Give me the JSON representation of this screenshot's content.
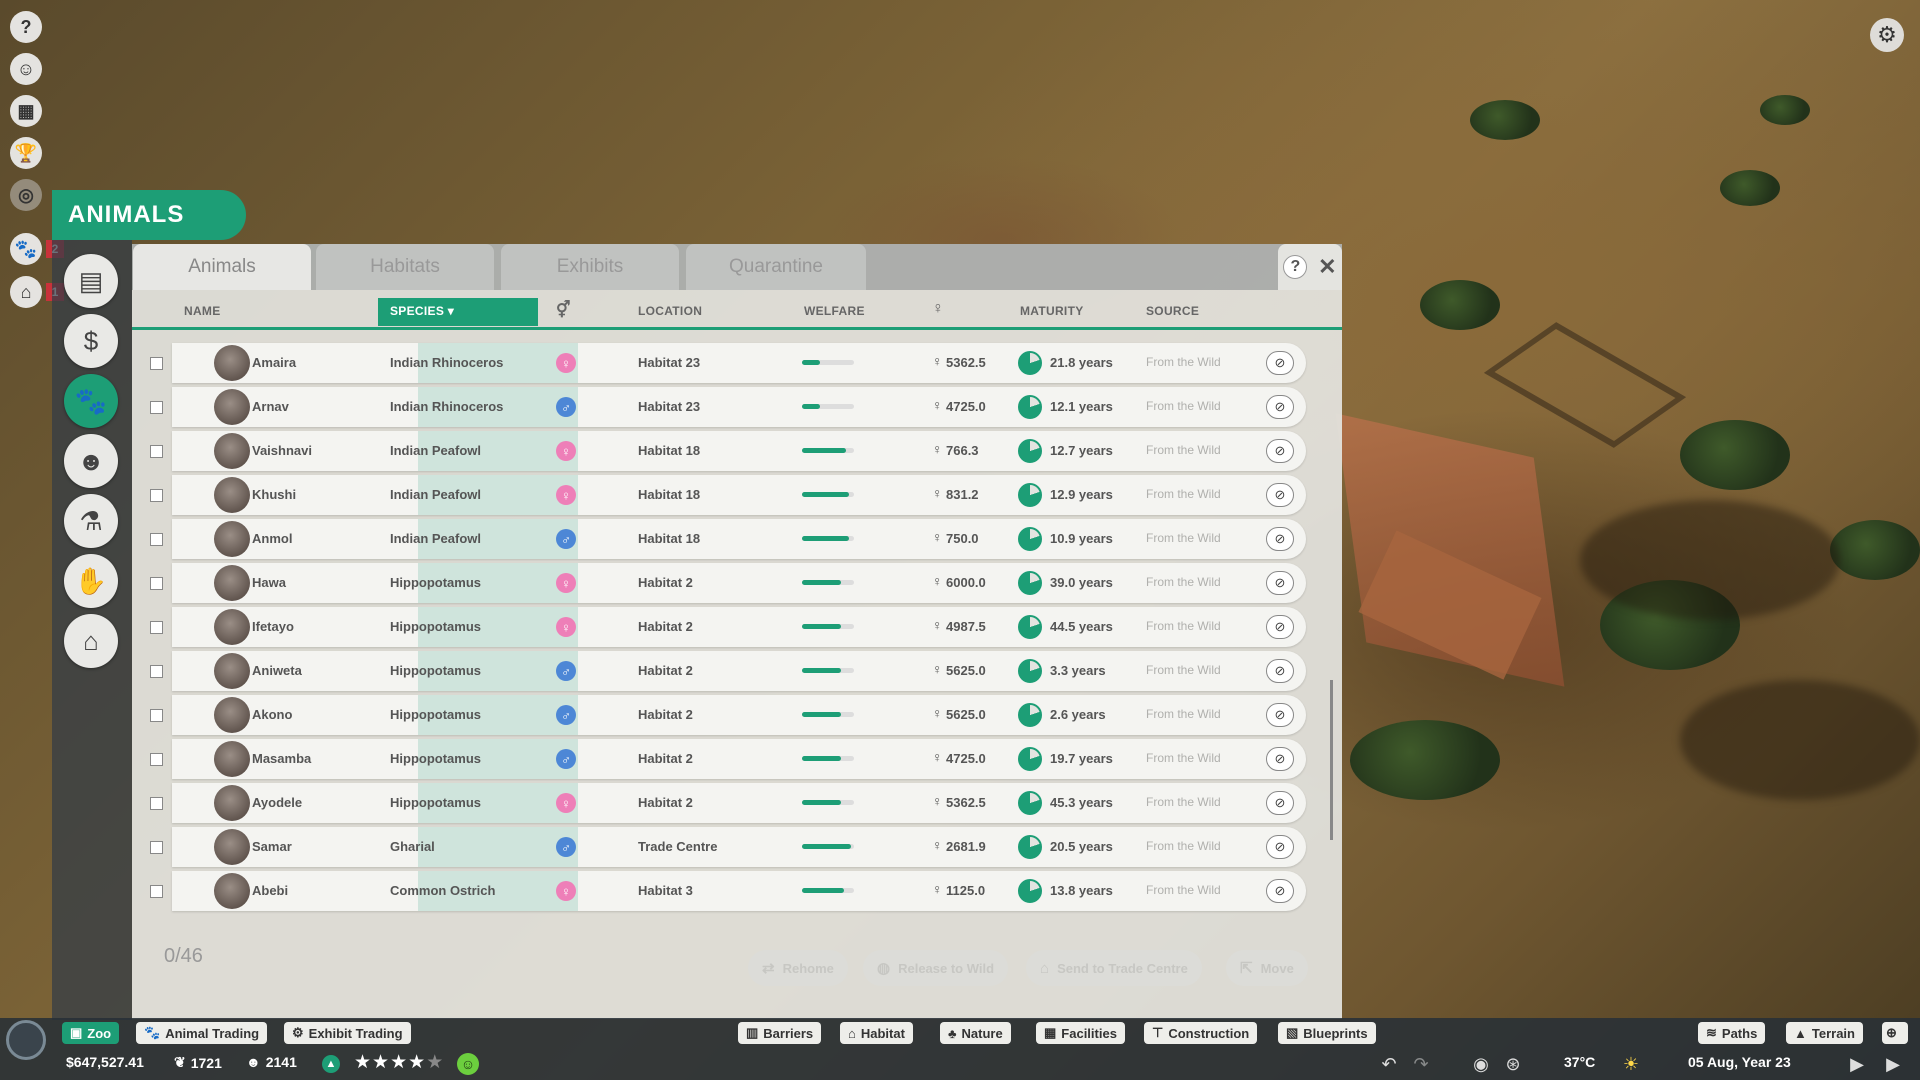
{
  "rail": {
    "icons": [
      "?",
      "☺",
      "▦",
      "🏆",
      "◎"
    ],
    "badges": [
      {
        "icon": "🐾",
        "count": "2"
      },
      {
        "icon": "⌂",
        "count": "1"
      }
    ]
  },
  "panel": {
    "title": "ANIMALS",
    "tabs": [
      "Animals",
      "Habitats",
      "Exhibits",
      "Quarantine"
    ],
    "help_label": "?",
    "close_label": "✕",
    "headers": {
      "name": "NAME",
      "species": "SPECIES ▾",
      "gender": "⚥",
      "location": "LOCATION",
      "welfare": "WELFARE",
      "value": "♀",
      "maturity": "MATURITY",
      "source": "SOURCE"
    },
    "selection_count": "0/46",
    "actions": {
      "rehome": "Rehome",
      "release": "Release to Wild",
      "trade": "Send to Trade Centre",
      "move": "Move"
    }
  },
  "animals": [
    {
      "name": "Amaira",
      "species": "Indian Rhinoceros",
      "gender": "female",
      "gender_icon": "♀",
      "location": "Habitat 23",
      "welfare": 0.35,
      "value": "5362.5",
      "maturity": "21.8 years",
      "source": "From the Wild"
    },
    {
      "name": "Arnav",
      "species": "Indian Rhinoceros",
      "gender": "male",
      "gender_icon": "♂",
      "location": "Habitat 23",
      "welfare": 0.35,
      "value": "4725.0",
      "maturity": "12.1 years",
      "source": "From the Wild"
    },
    {
      "name": "Vaishnavi",
      "species": "Indian Peafowl",
      "gender": "female",
      "gender_icon": "♀",
      "location": "Habitat 18",
      "welfare": 0.85,
      "value": "766.3",
      "maturity": "12.7 years",
      "source": "From the Wild"
    },
    {
      "name": "Khushi",
      "species": "Indian Peafowl",
      "gender": "female",
      "gender_icon": "♀",
      "location": "Habitat 18",
      "welfare": 0.9,
      "value": "831.2",
      "maturity": "12.9 years",
      "source": "From the Wild"
    },
    {
      "name": "Anmol",
      "species": "Indian Peafowl",
      "gender": "male",
      "gender_icon": "♂",
      "location": "Habitat 18",
      "welfare": 0.9,
      "value": "750.0",
      "maturity": "10.9 years",
      "source": "From the Wild"
    },
    {
      "name": "Hawa",
      "species": "Hippopotamus",
      "gender": "female",
      "gender_icon": "♀",
      "location": "Habitat 2",
      "welfare": 0.75,
      "value": "6000.0",
      "maturity": "39.0 years",
      "source": "From the Wild"
    },
    {
      "name": "Ifetayo",
      "species": "Hippopotamus",
      "gender": "female",
      "gender_icon": "♀",
      "location": "Habitat 2",
      "welfare": 0.75,
      "value": "4987.5",
      "maturity": "44.5 years",
      "source": "From the Wild"
    },
    {
      "name": "Aniweta",
      "species": "Hippopotamus",
      "gender": "male",
      "gender_icon": "♂",
      "location": "Habitat 2",
      "welfare": 0.75,
      "value": "5625.0",
      "maturity": "3.3 years",
      "source": "From the Wild"
    },
    {
      "name": "Akono",
      "species": "Hippopotamus",
      "gender": "male",
      "gender_icon": "♂",
      "location": "Habitat 2",
      "welfare": 0.75,
      "value": "5625.0",
      "maturity": "2.6 years",
      "source": "From the Wild"
    },
    {
      "name": "Masamba",
      "species": "Hippopotamus",
      "gender": "male",
      "gender_icon": "♂",
      "location": "Habitat 2",
      "welfare": 0.75,
      "value": "4725.0",
      "maturity": "19.7 years",
      "source": "From the Wild"
    },
    {
      "name": "Ayodele",
      "species": "Hippopotamus",
      "gender": "female",
      "gender_icon": "♀",
      "location": "Habitat 2",
      "welfare": 0.75,
      "value": "5362.5",
      "maturity": "45.3 years",
      "source": "From the Wild"
    },
    {
      "name": "Samar",
      "species": "Gharial",
      "gender": "male",
      "gender_icon": "♂",
      "location": "Trade Centre",
      "welfare": 0.95,
      "value": "2681.9",
      "maturity": "20.5 years",
      "source": "From the Wild"
    },
    {
      "name": "Abebi",
      "species": "Common Ostrich",
      "gender": "female",
      "gender_icon": "♀",
      "location": "Habitat 3",
      "welfare": 0.8,
      "value": "1125.0",
      "maturity": "13.8 years",
      "source": "From the Wild"
    }
  ],
  "bottom": {
    "left_buttons": [
      "Zoo",
      "Animal Trading",
      "Exhibit Trading"
    ],
    "build_buttons": [
      "Barriers",
      "Habitat",
      "Nature",
      "Facilities",
      "Construction",
      "Blueprints"
    ],
    "right_buttons": [
      "Paths",
      "Terrain"
    ],
    "money": "$647,527.41",
    "conservation": "1721",
    "guests": "2141",
    "rating_stars": 4,
    "rating_max": 5,
    "temperature": "37°C",
    "date": "05 Aug, Year 23"
  },
  "colors": {
    "accent": "#1d9e76",
    "female": "#ee7fb8",
    "male": "#4d87d6"
  }
}
